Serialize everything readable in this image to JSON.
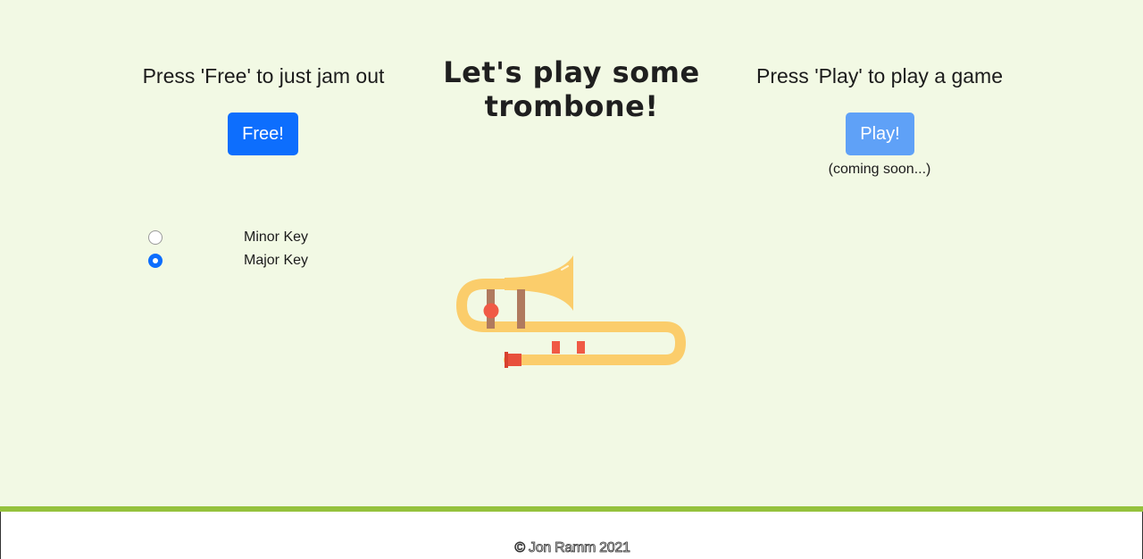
{
  "header": {
    "title": "Let's play some trombone!"
  },
  "free_section": {
    "prompt": "Press 'Free' to just jam out",
    "button_label": "Free!"
  },
  "play_section": {
    "prompt": "Press 'Play' to play a game",
    "button_label": "Play!",
    "note": "(coming soon...)"
  },
  "key_options": [
    {
      "label": "Minor Key",
      "selected": false
    },
    {
      "label": "Major Key",
      "selected": true
    }
  ],
  "trombone_image": {
    "icon": "trombone-icon"
  },
  "footer": {
    "copyright": "© Jon Ramm 2021"
  },
  "colors": {
    "background": "#f2f9e4",
    "primary_button": "#0d6efd",
    "disabled_button": "#5fa1f7",
    "footer_border": "#95c23d",
    "trombone_body": "#fbcd6b",
    "trombone_slide": "#b07a5e",
    "trombone_accent": "#f05a45"
  }
}
